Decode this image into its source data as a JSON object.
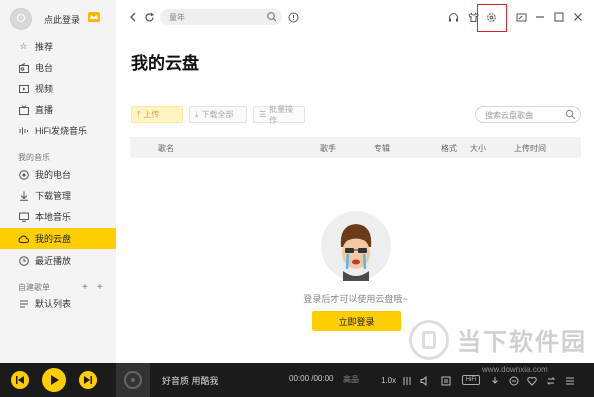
{
  "sidebar": {
    "user_name": "点此登录",
    "items": [
      {
        "label": "推荐",
        "icon": "star-icon"
      },
      {
        "label": "电台",
        "icon": "radio-icon"
      },
      {
        "label": "视频",
        "icon": "video-icon"
      },
      {
        "label": "直播",
        "icon": "live-icon"
      },
      {
        "label": "HiFi发烧音乐",
        "icon": "hifi-icon"
      }
    ],
    "section_my_music": "我的音乐",
    "my_items": [
      {
        "label": "我的电台",
        "icon": "my-radio-icon"
      },
      {
        "label": "下载管理",
        "icon": "download-icon"
      },
      {
        "label": "本地音乐",
        "icon": "local-music-icon"
      },
      {
        "label": "我的云盘",
        "icon": "cloud-icon"
      },
      {
        "label": "最近播放",
        "icon": "clock-icon"
      }
    ],
    "section_playlists": "自建歌单",
    "playlist_items": [
      {
        "label": "默认列表",
        "icon": "list-icon"
      }
    ]
  },
  "topbar": {
    "search_value": "童年"
  },
  "main": {
    "title": "我的云盘",
    "toolbar": {
      "upload": "上传",
      "download_all": "下载全部",
      "batch": "批量操作"
    },
    "search_placeholder": "搜索云盘歌曲",
    "columns": [
      "歌名",
      "歌手",
      "专辑",
      "格式",
      "大小",
      "上传时间"
    ],
    "empty_text": "登录后才可以使用云盘哦~",
    "login_button": "立即登录"
  },
  "player": {
    "song": "好音质 用酷我",
    "time": "00:00 /00:00",
    "quality": "高品",
    "speed": "1.0x",
    "hifi": "HiFi"
  },
  "watermark": {
    "text": "当下软件园",
    "url": "www.downxia.com"
  },
  "colors": {
    "accent": "#ffce00",
    "highlight": "#e0202a"
  }
}
